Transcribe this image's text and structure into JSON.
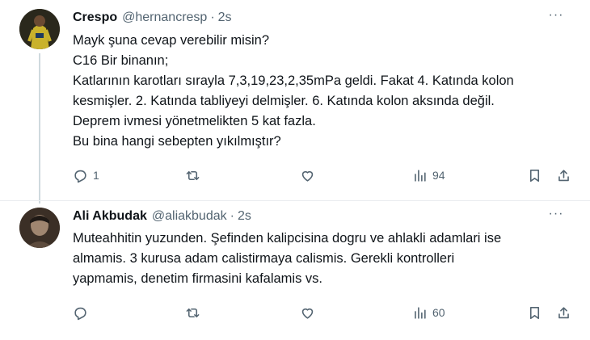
{
  "tweets": [
    {
      "author": {
        "name": "Crespo",
        "handle": "@hernancresp"
      },
      "time": "2s",
      "lines": [
        "Mayk şuna cevap verebilir misin?",
        "C16 Bir binanın;",
        "Katlarının karotları sırayla 7,3,19,23,2,35mPa geldi. Fakat 4. Katında kolon",
        "kesmişler. 2. Katında tabliyeyi delmişler. 6. Katında kolon aksında değil.",
        "Deprem ivmesi yönetmelikten 5 kat fazla.",
        "Bu bina hangi sebepten yıkılmıştır?"
      ],
      "actions": {
        "replies": "1",
        "views": "94"
      }
    },
    {
      "author": {
        "name": "Ali Akbudak",
        "handle": "@aliakbudak"
      },
      "time": "2s",
      "lines": [
        "Muteahhitin yuzunden. Şefinden kalipcisina dogru ve ahlakli adamlari ise",
        "almamis. 3 kurusa adam calistirmaya calismis. Gerekli kontrolleri",
        "yapmamis, denetim firmasini kafalamis vs."
      ],
      "actions": {
        "views": "60"
      }
    }
  ],
  "more_glyph": "···",
  "dot_glyph": "·",
  "icons": [
    "reply-icon",
    "retweet-icon",
    "like-icon",
    "views-icon",
    "bookmark-icon",
    "share-icon"
  ]
}
